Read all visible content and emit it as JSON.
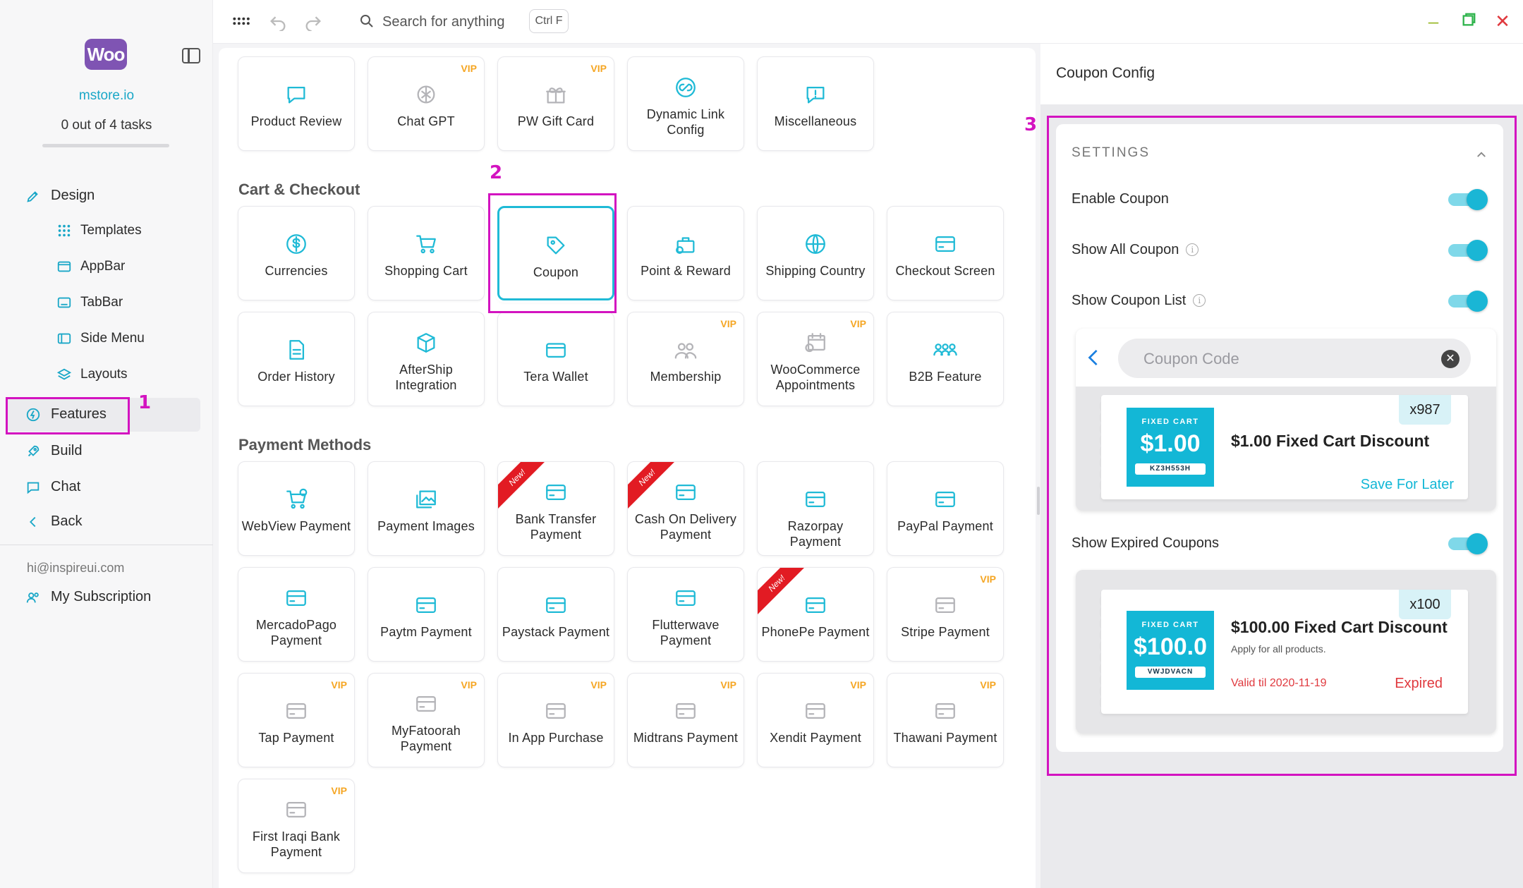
{
  "sidebar": {
    "logo_text": "Woo",
    "store": "mstore.io",
    "tasks": "0 out of 4 tasks",
    "nav": {
      "design": "Design",
      "templates": "Templates",
      "appbar": "AppBar",
      "tabbar": "TabBar",
      "side_menu": "Side Menu",
      "layouts": "Layouts",
      "features": "Features",
      "build": "Build",
      "chat": "Chat",
      "back": "Back"
    },
    "email": "hi@inspireui.com",
    "subscription": "My Subscription"
  },
  "topbar": {
    "search_placeholder": "Search for anything",
    "shortcut": "Ctrl F"
  },
  "center": {
    "top_cards": [
      {
        "label": "Product Review",
        "vip": ""
      },
      {
        "label": "Chat GPT",
        "vip": "VIP"
      },
      {
        "label": "PW Gift Card",
        "vip": "VIP"
      },
      {
        "label": "Dynamic Link Config",
        "vip": ""
      },
      {
        "label": "Miscellaneous",
        "vip": ""
      }
    ],
    "cart_title": "Cart & Checkout",
    "cart_cards": [
      {
        "label": "Currencies"
      },
      {
        "label": "Shopping Cart"
      },
      {
        "label": "Coupon"
      },
      {
        "label": "Point & Reward"
      },
      {
        "label": "Shipping Country"
      },
      {
        "label": "Checkout Screen"
      },
      {
        "label": "Order History"
      },
      {
        "label": "AfterShip Integration"
      },
      {
        "label": "Tera Wallet"
      },
      {
        "label": "Membership",
        "vip": "VIP"
      },
      {
        "label": "WooCommerce Appointments",
        "vip": "VIP"
      },
      {
        "label": "B2B Feature"
      }
    ],
    "payment_title": "Payment Methods",
    "payment_cards": [
      {
        "label": "WebView Payment"
      },
      {
        "label": "Payment Images"
      },
      {
        "label": "Bank Transfer Payment",
        "ribbon": "New!"
      },
      {
        "label": "Cash On Delivery Payment",
        "ribbon": "New!"
      },
      {
        "label": "Razorpay Payment"
      },
      {
        "label": "PayPal Payment"
      },
      {
        "label": "MercadoPago Payment"
      },
      {
        "label": "Paytm Payment"
      },
      {
        "label": "Paystack Payment"
      },
      {
        "label": "Flutterwave Payment"
      },
      {
        "label": "PhonePe Payment",
        "ribbon": "New!"
      },
      {
        "label": "Stripe Payment",
        "vip": "VIP"
      },
      {
        "label": "Tap Payment",
        "vip": "VIP"
      },
      {
        "label": "MyFatoorah Payment",
        "vip": "VIP"
      },
      {
        "label": "In App Purchase",
        "vip": "VIP"
      },
      {
        "label": "Midtrans Payment",
        "vip": "VIP"
      },
      {
        "label": "Xendit Payment",
        "vip": "VIP"
      },
      {
        "label": "Thawani Payment",
        "vip": "VIP"
      },
      {
        "label": "First Iraqi Bank Payment",
        "vip": "VIP"
      }
    ]
  },
  "annotations": {
    "one": "1",
    "two": "2",
    "three": "3"
  },
  "right": {
    "title": "Coupon Config",
    "settings_header": "SETTINGS",
    "toggles": {
      "enable": "Enable Coupon",
      "show_all": "Show All Coupon",
      "show_list": "Show Coupon List",
      "show_expired": "Show Expired Coupons"
    },
    "preview1": {
      "search_placeholder": "Coupon Code",
      "tag_type": "FIXED CART",
      "amount": "$1.00",
      "code": "KZ3H553H",
      "title": "$1.00 Fixed Cart Discount",
      "qty": "x987",
      "action": "Save For Later"
    },
    "preview2": {
      "tag_type": "FIXED CART",
      "amount": "$100.0",
      "code": "VWJDVACN",
      "title": "$100.00 Fixed Cart Discount",
      "subtitle": "Apply for all products.",
      "qty": "x100",
      "valid": "Valid til 2020-11-19",
      "status": "Expired"
    }
  },
  "colors": {
    "accent": "#1fbad6",
    "vip": "#f5a623",
    "annotation": "#d313c0",
    "ribbon": "#e21b23"
  }
}
